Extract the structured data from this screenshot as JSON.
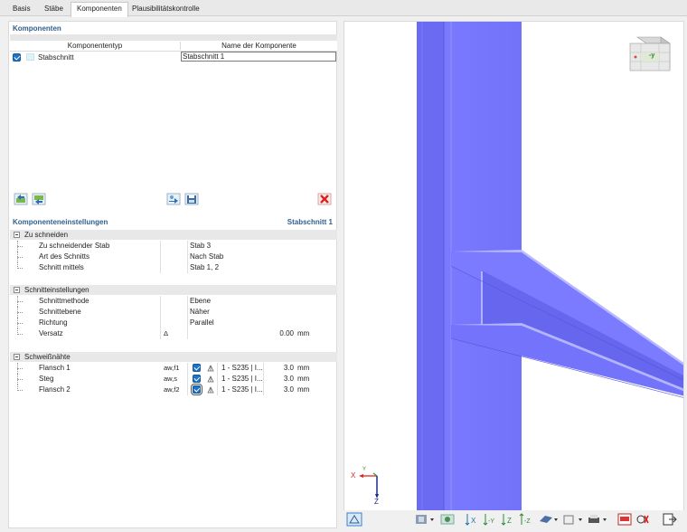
{
  "tabs": [
    {
      "label": "Basis"
    },
    {
      "label": "Stäbe"
    },
    {
      "label": "Komponenten"
    },
    {
      "label": "Plausibilitätskontrolle"
    }
  ],
  "components": {
    "title": "Komponenten",
    "col_type": "Komponententyp",
    "col_name": "Name der Komponente",
    "rows": [
      {
        "type": "Stabschnitt",
        "name": "Stabschnitt 1",
        "checked": true
      }
    ]
  },
  "settings": {
    "title": "Komponenteneinstellungen",
    "selected": "Stabschnitt 1",
    "groups": [
      {
        "label": "Zu schneiden",
        "rows": [
          {
            "name": "Zu schneidender Stab",
            "value": "Stab 3"
          },
          {
            "name": "Art des Schnitts",
            "value": "Nach Stab"
          },
          {
            "name": "Schnitt mittels",
            "value": "Stab 1, 2"
          }
        ]
      },
      {
        "label": "Schnitteinstellungen",
        "rows": [
          {
            "name": "Schnittmethode",
            "value": "Ebene"
          },
          {
            "name": "Schnittebene",
            "value": "Näher"
          },
          {
            "name": "Richtung",
            "value": "Parallel"
          },
          {
            "name": "Versatz",
            "symbol": "Δ",
            "number": "0.00",
            "unit": "mm"
          }
        ]
      },
      {
        "label": "Schweißnähte",
        "rows": [
          {
            "name": "Flansch 1",
            "symbol": "aw,f1",
            "material": "1 - S235 | I...",
            "number": "3.0",
            "unit": "mm"
          },
          {
            "name": "Steg",
            "symbol": "aw,s",
            "material": "1 - S235 | I...",
            "number": "3.0",
            "unit": "mm"
          },
          {
            "name": "Flansch 2",
            "symbol": "aw,f2",
            "material": "1 - S235 | I...",
            "number": "3.0",
            "unit": "mm"
          }
        ]
      }
    ]
  },
  "view": {
    "axes": {
      "x": "X",
      "y": "Y",
      "z": "Z"
    },
    "cube_face": "-y",
    "steel_color": "#7070ff"
  }
}
